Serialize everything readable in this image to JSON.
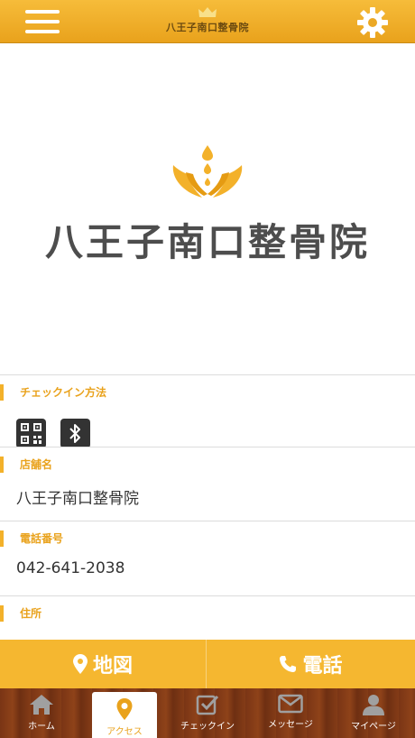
{
  "header": {
    "title": "八王子南口整骨院",
    "menu_icon": "hamburger-icon",
    "settings_icon": "gear-icon"
  },
  "hero": {
    "title": "八王子南口整骨院"
  },
  "checkin": {
    "label": "チェックイン方法",
    "icons": [
      "qr-code-icon",
      "bluetooth-icon"
    ]
  },
  "store": {
    "label": "店舗名",
    "value": "八王子南口整骨院"
  },
  "phone": {
    "label": "電話番号",
    "value": "042-641-2038"
  },
  "address": {
    "label": "住所"
  },
  "actions": {
    "map_label": "地図",
    "tel_label": "電話"
  },
  "tabs": [
    {
      "label": "ホーム",
      "icon": "home-icon"
    },
    {
      "label": "アクセス",
      "icon": "map-pin-icon"
    },
    {
      "label": "チェックイン",
      "icon": "checkin-icon"
    },
    {
      "label": "メッセージ",
      "icon": "mail-icon"
    },
    {
      "label": "マイページ",
      "icon": "user-icon"
    }
  ],
  "colors": {
    "accent": "#f3b12a",
    "header": "#e9a21c",
    "wood": "#7a3515"
  }
}
